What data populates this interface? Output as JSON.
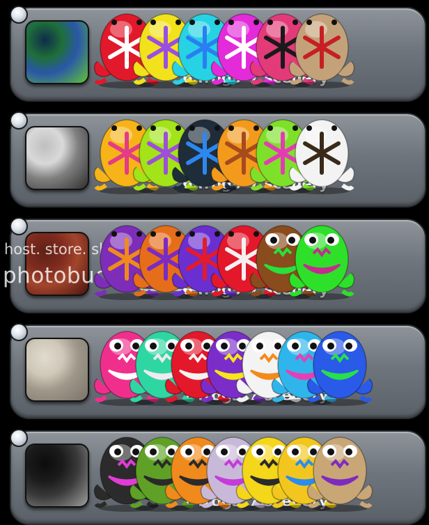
{
  "packs": [
    {
      "frogs_label": "6 frogs",
      "scenery_label": "7 scenery",
      "thumb_colors": [
        "#1f6f3a",
        "#2a57a8",
        "#61c436",
        "#0f2c4a"
      ],
      "frog_colors": [
        "#e2182b",
        "#f2e21b",
        "#26d2e3",
        "#e32bd9",
        "#e33b79",
        "#c3a27a"
      ],
      "frog_pattern_colors": [
        "#ffffff",
        "#9a4fe0",
        "#2a7ef2",
        "#ffffff",
        "#1a1a1a",
        "#c61f23"
      ],
      "frog_icons": [
        "snowflake-frog-icon",
        "snowflake-frog-icon",
        "snowflake-frog-icon",
        "snowflake-frog-icon",
        "snowflake-frog-icon",
        "snowflake-frog-icon"
      ]
    },
    {
      "frogs_label": "6 frogs",
      "scenery_label": "7 scenery",
      "thumb_colors": [
        "#d9d9d9",
        "#7f7f7f",
        "#2f2f2f",
        "#bfbfbf"
      ],
      "frog_colors": [
        "#f6b418",
        "#a2e31a",
        "#1f2d3a",
        "#f39a1d",
        "#7fe02a",
        "#f3f3f3"
      ],
      "frog_pattern_colors": [
        "#e23c86",
        "#9d4fd8",
        "#2d88ee",
        "#a64b1d",
        "#e43bb4",
        "#3a2a1a"
      ],
      "frog_icons": [
        "snowflake-frog-icon",
        "snowflake-frog-icon",
        "snowflake-frog-icon",
        "snowflake-frog-icon",
        "snowflake-frog-icon",
        "snowflake-frog-icon"
      ]
    },
    {
      "frogs_label": "6 frogs",
      "scenery_label": "7 scenery",
      "thumb_colors": [
        "#7e2a1e",
        "#a3452c",
        "#4b140e",
        "#5e2216"
      ],
      "frog_colors": [
        "#7d2db8",
        "#e66e1b",
        "#6a2fd0",
        "#e3182b",
        "#8a4b1d",
        "#2ee02a"
      ],
      "frog_pattern_colors": [
        "#f08a1d",
        "#7c2bc0",
        "#e31b2b",
        "#f5f0f0",
        "#2ae03a",
        "#c52b8e"
      ],
      "frog_icons": [
        "snowflake-frog-icon",
        "snowflake-frog-icon",
        "snowflake-frog-icon",
        "snowflake-frog-icon",
        "jackolantern-frog-icon",
        "jackolantern-frog-icon"
      ]
    },
    {
      "frogs_label": "7 frogs",
      "scenery_label": "7 scenery",
      "thumb_colors": [
        "#cfc8b8",
        "#9e978a",
        "#7a7468",
        "#e0dbcf"
      ],
      "frog_colors": [
        "#f02f8d",
        "#2ed7a1",
        "#e3182b",
        "#7b2dc9",
        "#f3f3f3",
        "#2fb5ec",
        "#2a5ae8"
      ],
      "frog_pattern_colors": [
        "#ffffff",
        "#f0e9ee",
        "#f3f3f3",
        "#f6e61a",
        "#f48a1a",
        "#e63fb4",
        "#27e04a"
      ],
      "frog_icons": [
        "jackolantern-frog-icon",
        "jackolantern-frog-icon",
        "jackolantern-frog-icon",
        "jackolantern-frog-icon",
        "jackolantern-frog-icon",
        "jackolantern-frog-icon",
        "jackolantern-frog-icon"
      ]
    },
    {
      "frogs_label": "7 frogs",
      "scenery_label": "7 scenery",
      "thumb_colors": [
        "#1b1b1b",
        "#3a3a3a",
        "#9e9e9e",
        "#0c0c0c"
      ],
      "frog_colors": [
        "#2b2b2b",
        "#5fa126",
        "#f08a1d",
        "#c9b9d8",
        "#f4d61b",
        "#f3c61f",
        "#c9a676"
      ],
      "frog_pattern_colors": [
        "#e33bd7",
        "#2a2a2a",
        "#2b2b2b",
        "#c53bd9",
        "#2b2b2b",
        "#2a8cee",
        "#7d2bbf"
      ],
      "frog_icons": [
        "jackolantern-frog-icon",
        "jackolantern-frog-icon",
        "jackolantern-frog-icon",
        "jackolantern-frog-icon",
        "jackolantern-frog-icon",
        "jackolantern-frog-icon",
        "jackolantern-frog-icon"
      ]
    }
  ],
  "watermark": {
    "host_line": "host. store. share.",
    "brand": "photobucket"
  }
}
